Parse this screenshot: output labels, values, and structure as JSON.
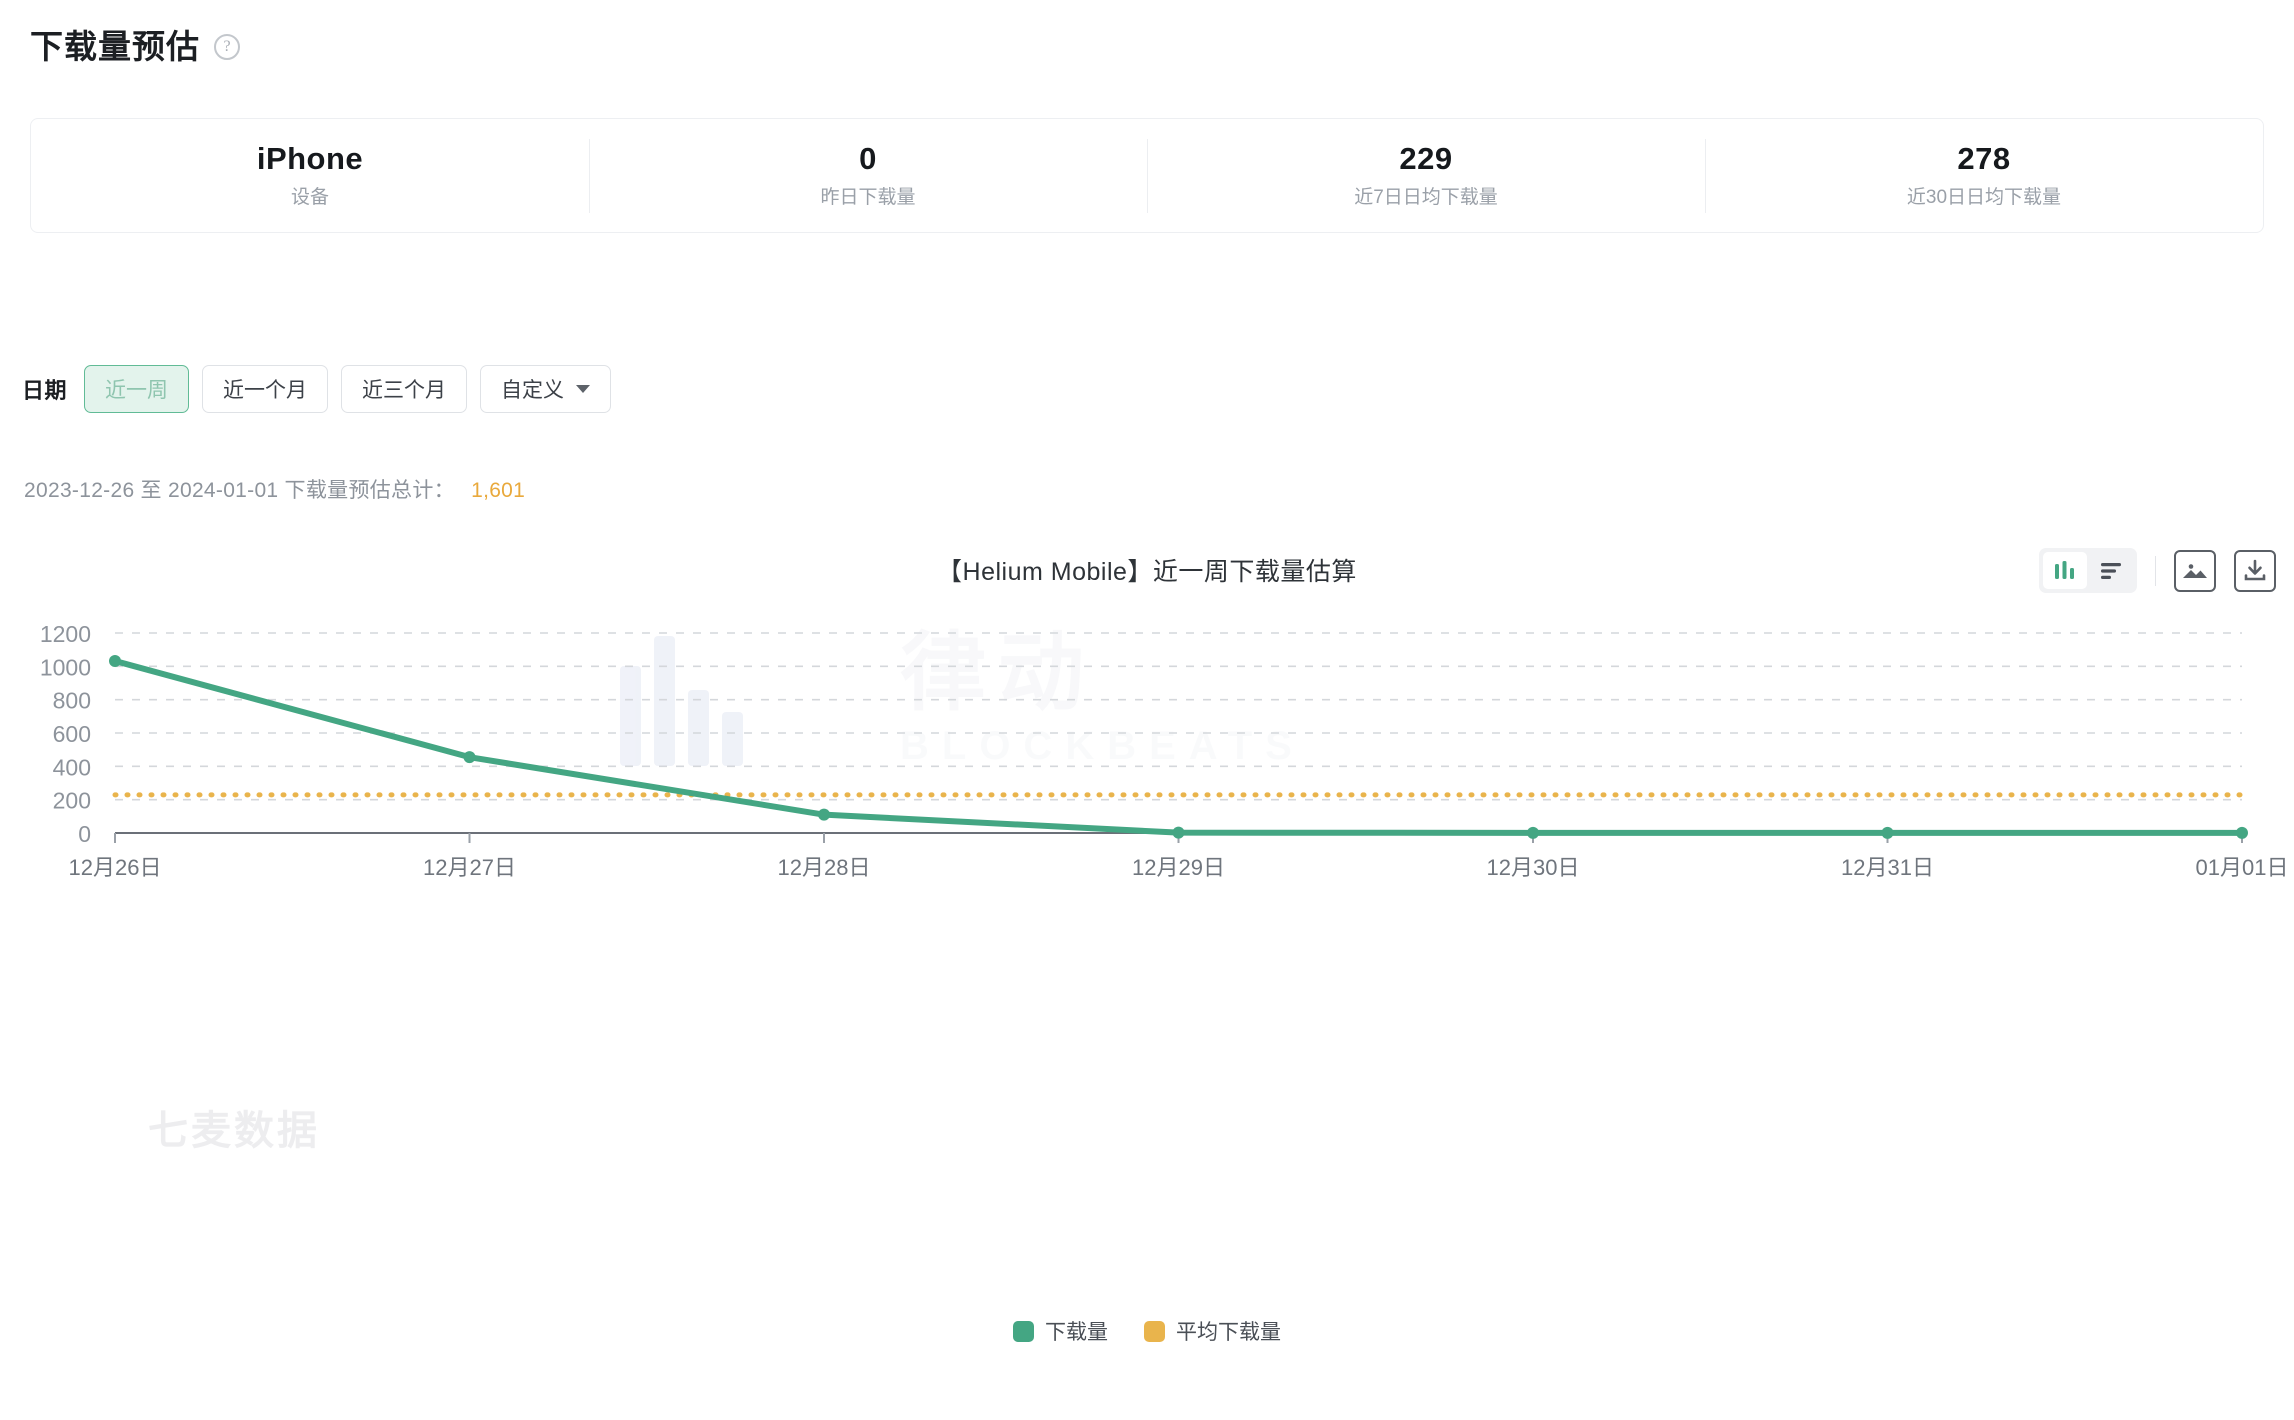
{
  "header": {
    "title": "下载量预估",
    "help_icon": "question-mark-icon"
  },
  "stats": [
    {
      "value": "iPhone",
      "label": "设备"
    },
    {
      "value": "0",
      "label": "昨日下载量"
    },
    {
      "value": "229",
      "label": "近7日日均下载量"
    },
    {
      "value": "278",
      "label": "近30日日均下载量"
    }
  ],
  "filters": {
    "legend": "日期",
    "options": [
      {
        "label": "近一周",
        "active": true
      },
      {
        "label": "近一个月",
        "active": false
      },
      {
        "label": "近三个月",
        "active": false
      },
      {
        "label": "自定义",
        "active": false,
        "has_caret": true
      }
    ]
  },
  "summary": {
    "range_text": "2023-12-26 至 2024-01-01 下载量预估总计：",
    "total": "1,601"
  },
  "toolbar": {
    "chart_view_icon": "bar-chart-icon",
    "table_view_icon": "list-view-icon",
    "image_icon": "image-export-icon",
    "download_icon": "download-icon"
  },
  "watermarks": {
    "center_cn": "律动",
    "center_en": "BLOCKBEATS",
    "left": "七麦数据"
  },
  "colors": {
    "line_green": "#44a683",
    "avg_orange": "#e9b44c",
    "accent_total": "#e9a93c",
    "chip_active_bg": "#e3f3ec",
    "chip_active_border": "#61bb96"
  },
  "chart_data": {
    "type": "line",
    "title": "【Helium Mobile】近一周下载量估算",
    "xlabel": "",
    "ylabel": "",
    "ylim": [
      0,
      1200
    ],
    "yticks": [
      0,
      200,
      400,
      600,
      800,
      1000,
      1200
    ],
    "grid": true,
    "legend_position": "bottom",
    "categories": [
      "12月26日",
      "12月27日",
      "12月28日",
      "12月29日",
      "12月30日",
      "12月31日",
      "01月01日"
    ],
    "series": [
      {
        "name": "下载量",
        "type": "line",
        "color": "#44a683",
        "values": [
          1032,
          455,
          110,
          2,
          1,
          1,
          1
        ]
      },
      {
        "name": "平均下载量",
        "type": "threshold-line",
        "color": "#e9b44c",
        "value": 229,
        "values": [
          229,
          229,
          229,
          229,
          229,
          229,
          229
        ]
      }
    ]
  }
}
